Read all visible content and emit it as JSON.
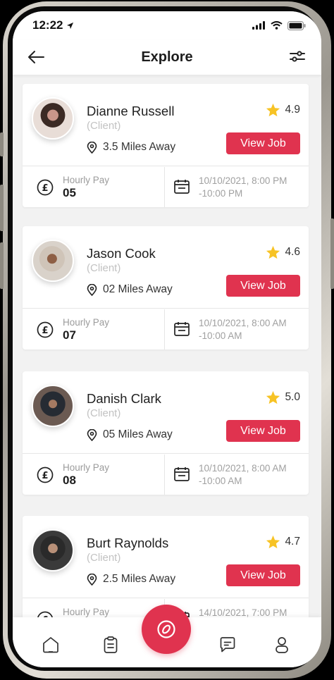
{
  "status_bar": {
    "time": "12:22"
  },
  "header": {
    "title": "Explore"
  },
  "jobs": [
    {
      "name": "Dianne Russell",
      "role": "(Client)",
      "distance": "3.5 Miles Away",
      "rating": "4.9",
      "button": "View Job",
      "pay_label": "Hourly Pay",
      "pay_value": "05",
      "time_line1": "10/10/2021, 8:00 PM",
      "time_line2": "-10:00 PM"
    },
    {
      "name": "Jason Cook",
      "role": "(Client)",
      "distance": "02 Miles Away",
      "rating": "4.6",
      "button": "View Job",
      "pay_label": "Hourly Pay",
      "pay_value": "07",
      "time_line1": "10/10/2021, 8:00 AM",
      "time_line2": "-10:00 AM"
    },
    {
      "name": "Danish Clark",
      "role": "(Client)",
      "distance": "05 Miles Away",
      "rating": "5.0",
      "button": "View Job",
      "pay_label": "Hourly Pay",
      "pay_value": "08",
      "time_line1": "10/10/2021, 8:00 AM",
      "time_line2": "-10:00 AM"
    },
    {
      "name": "Burt Raynolds",
      "role": "(Client)",
      "distance": "2.5 Miles Away",
      "rating": "4.7",
      "button": "View Job",
      "pay_label": "Hourly Pay",
      "pay_value": "",
      "time_line1": "14/10/2021, 7:00 PM",
      "time_line2": ""
    }
  ],
  "bottom_nav": {
    "items": [
      "home-icon",
      "clipboard-icon",
      "explore-icon",
      "chat-icon",
      "profile-icon"
    ],
    "active": "explore-icon"
  },
  "colors": {
    "accent": "#e0334f",
    "star": "#f7c325",
    "background": "#f2f2f2"
  }
}
